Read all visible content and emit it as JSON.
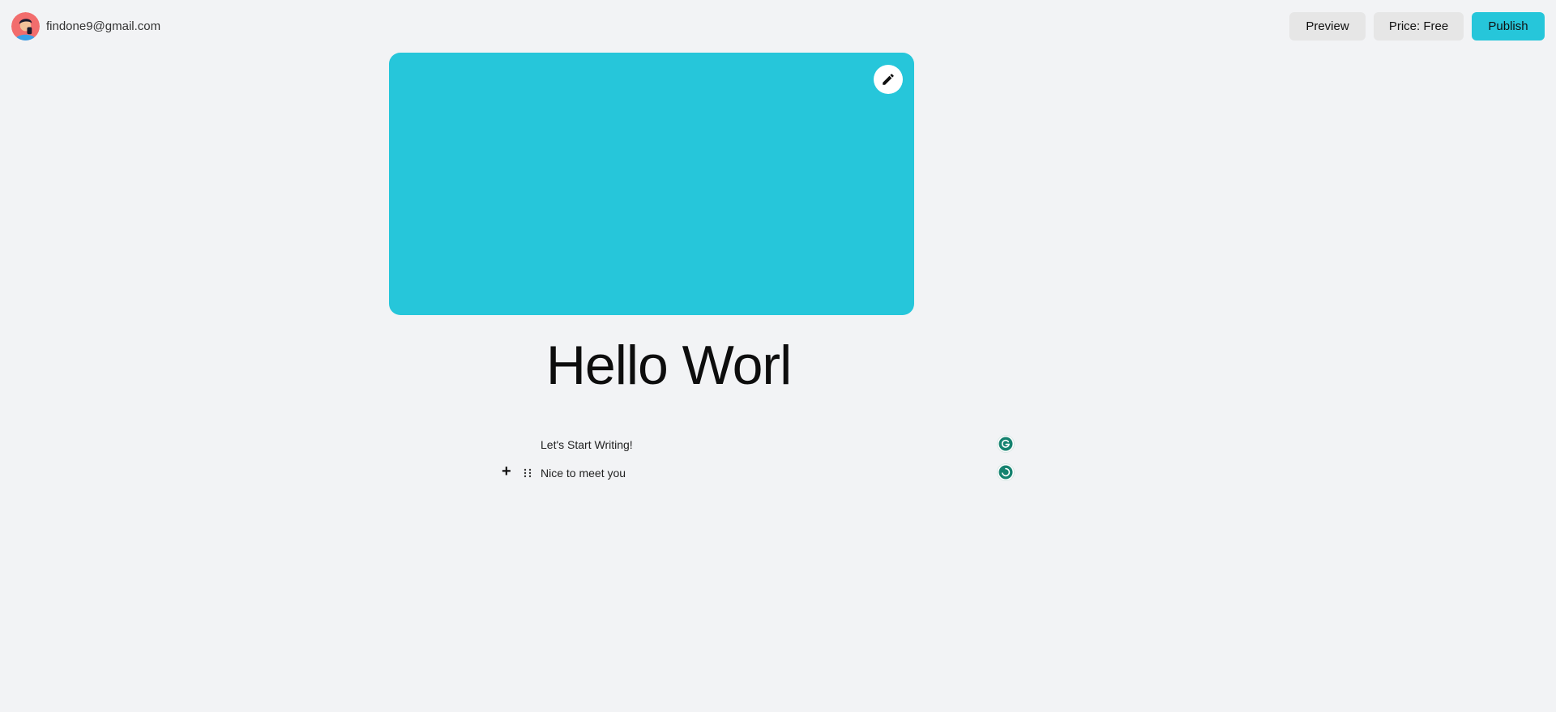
{
  "user": {
    "email": "findone9@gmail.com",
    "avatar_icon": "user-avatar-icon"
  },
  "toolbar": {
    "preview_label": "Preview",
    "price_label": "Price: Free",
    "publish_label": "Publish"
  },
  "cover": {
    "color": "#26c6da",
    "edit_icon": "pencil-icon"
  },
  "post": {
    "title": "Hello Worl",
    "blocks": [
      {
        "text": "Let's Start Writing!"
      },
      {
        "text": "Nice to meet you"
      }
    ]
  },
  "colors": {
    "accent": "#26c6da",
    "background": "#f2f3f5",
    "button_gray": "#e6e6e6",
    "grammarly_green": "#15826f"
  }
}
